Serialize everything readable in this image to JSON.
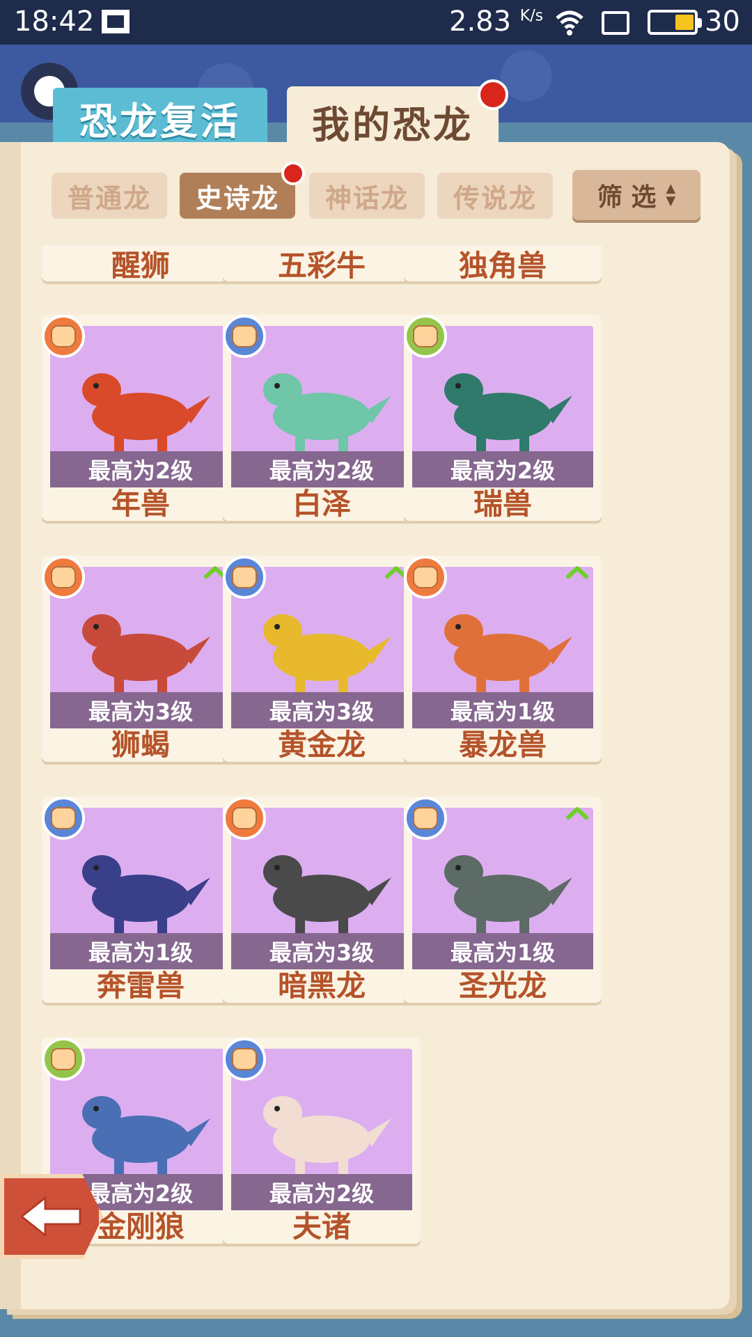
{
  "status_bar": {
    "time": "18:42",
    "network_speed": "2.83",
    "speed_unit": "K/s",
    "battery_percent": "30",
    "battery_level": 0.3
  },
  "tabs": {
    "revive": "恐龙复活",
    "my_dinos": "我的恐龙"
  },
  "subtabs": [
    {
      "label": "普通龙",
      "active": false
    },
    {
      "label": "史诗龙",
      "active": true
    },
    {
      "label": "神话龙",
      "active": false
    },
    {
      "label": "传说龙",
      "active": false
    }
  ],
  "filter": {
    "label": "筛 选"
  },
  "cards_partial": [
    {
      "name": "醒狮"
    },
    {
      "name": "五彩牛"
    },
    {
      "name": "独角兽"
    }
  ],
  "cards": [
    {
      "name": "年兽",
      "level": "最高为2级",
      "badge": "orange",
      "hand": "paper",
      "upgrade": false,
      "color": "#d94a2a"
    },
    {
      "name": "白泽",
      "level": "最高为2级",
      "badge": "blue",
      "hand": "rock",
      "upgrade": false,
      "color": "#6fc6a8"
    },
    {
      "name": "瑞兽",
      "level": "最高为2级",
      "badge": "green",
      "hand": "scissors",
      "upgrade": false,
      "color": "#2f7a6a"
    },
    {
      "name": "狮蝎",
      "level": "最高为3级",
      "badge": "orange",
      "hand": "paper",
      "upgrade": true,
      "color": "#c84a3a"
    },
    {
      "name": "黄金龙",
      "level": "最高为3级",
      "badge": "blue",
      "hand": "rock",
      "upgrade": true,
      "color": "#e8b92c"
    },
    {
      "name": "暴龙兽",
      "level": "最高为1级",
      "badge": "orange",
      "hand": "paper",
      "upgrade": true,
      "color": "#e0703a"
    },
    {
      "name": "奔雷兽",
      "level": "最高为1级",
      "badge": "blue",
      "hand": "rock",
      "upgrade": false,
      "color": "#3a3f8a"
    },
    {
      "name": "暗黑龙",
      "level": "最高为3级",
      "badge": "orange",
      "hand": "paper",
      "upgrade": false,
      "color": "#4a4a4a"
    },
    {
      "name": "圣光龙",
      "level": "最高为1级",
      "badge": "blue",
      "hand": "rock",
      "upgrade": true,
      "color": "#5d6b66"
    },
    {
      "name": "金刚狼",
      "level": "最高为2级",
      "badge": "green",
      "hand": "scissors",
      "upgrade": false,
      "color": "#4a6fb5"
    },
    {
      "name": "夫诸",
      "level": "最高为2级",
      "badge": "blue",
      "hand": "rock",
      "upgrade": false,
      "color": "#f2ddd2"
    }
  ],
  "colors": {
    "header": "#3d5aa0",
    "page": "#f6ecd8",
    "card_portrait": "#dcaef0",
    "level_bar": "#86678f",
    "name_text": "#b5532a",
    "active_subtab": "#b07f58",
    "back_button": "#cf5038"
  }
}
